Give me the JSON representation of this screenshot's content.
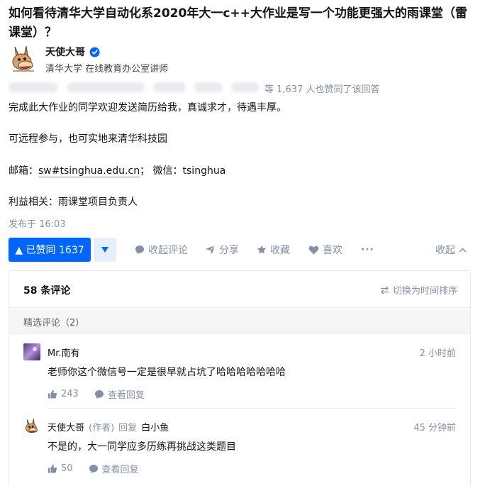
{
  "question": {
    "title": "如何看待清华大学自动化系2020年大一c++大作业是写一个功能更强大的雨课堂（雷课堂）？"
  },
  "author": {
    "name": "天使大哥",
    "headline": "清华大学 在线教育办公室讲师",
    "avatar_icon": "cartoon-donkey-avatar"
  },
  "voters_text": "等 1,637 人也赞同了该回答",
  "content": {
    "line1": "完成此大作业的同学欢迎发送简历给我，真诚求才，待遇丰厚。",
    "line2": "可远程参与，也可实地来清华科技园",
    "line3_prefix": "邮箱：",
    "line3_email": "sw#tsinghua.edu.cn",
    "line3_suffix": "； 微信：tsinghua",
    "line4": "利益相关：雨课堂项目负责人"
  },
  "publish_time": "发布于 16:03",
  "actions": {
    "vote_label": "▲ 已赞同 1637",
    "collapse_comments": "收起评论",
    "share": "分享",
    "favorite": "收藏",
    "like": "喜欢",
    "more": "···",
    "collapse": "收起"
  },
  "comments": {
    "count_label": "58 条评论",
    "sort_label": "切换为时间排序",
    "featured_label": "精选评论（2）",
    "items": [
      {
        "name": "Mr.南有",
        "time": "2 小时前",
        "text": "老师你这个微信号一定是很早就占坑了哈哈哈哈哈哈哈",
        "likes": "243",
        "view_replies": "查看回复"
      },
      {
        "name": "天使大哥",
        "author_tag": "(作者)",
        "reply_word": "回复",
        "reply_to": "白小鱼",
        "time": "45 分钟前",
        "text": "不是的，大一同学应多历练再挑战这类题目",
        "likes": "50",
        "view_replies": "查看回复"
      }
    ]
  },
  "colors": {
    "brand_blue": "#0066ff",
    "vote_down_bg": "#e5efff",
    "muted_text": "#8590a6"
  }
}
